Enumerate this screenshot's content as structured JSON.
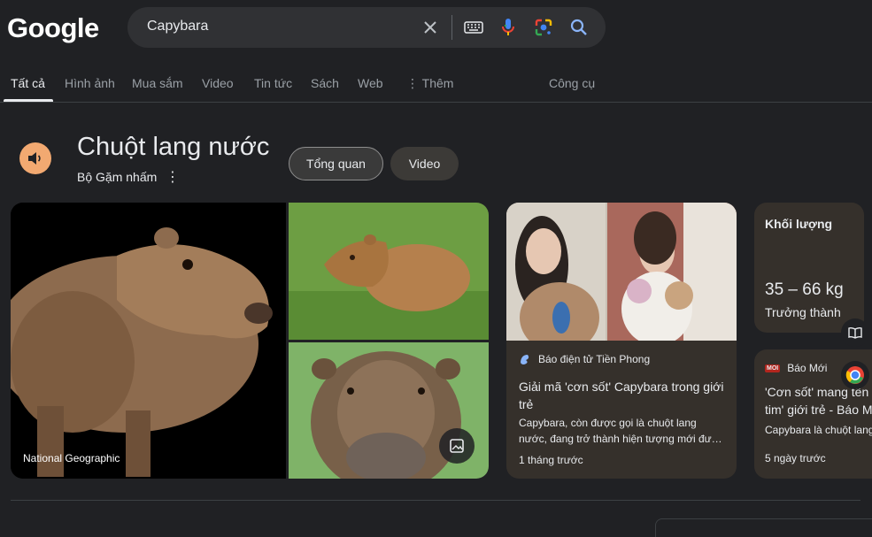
{
  "logo": "Google",
  "search": {
    "query": "Capybara"
  },
  "icons": {
    "clear": "close-icon",
    "keyboard": "keyboard-icon",
    "voice": "microphone-icon",
    "lens": "google-lens-icon",
    "search": "search-icon"
  },
  "tabs": [
    {
      "label": "Tất cả"
    },
    {
      "label": "Hình ảnh"
    },
    {
      "label": "Mua sắm"
    },
    {
      "label": "Video"
    },
    {
      "label": "Tin tức"
    },
    {
      "label": "Sách"
    },
    {
      "label": "Web"
    },
    {
      "label": "Thêm"
    }
  ],
  "tools_label": "Công cụ",
  "knowledge": {
    "title": "Chuột lang nước",
    "subtitle": "Bộ Gặm nhấm",
    "more": "⋮",
    "chips": [
      "Tổng quan",
      "Video"
    ]
  },
  "images": {
    "credit": "National Geographic"
  },
  "weight": {
    "label": "Khối lượng",
    "value": "35 – 66 kg",
    "sub": "Trưởng thành"
  },
  "news": [
    {
      "source": "Báo điện tử Tiền Phong",
      "title": "Giải mã 'cơn sốt' Capybara trong giới trẻ",
      "snippet": "Capybara, còn được gọi là chuột lang nước, đang trở thành hiện tượng mới đư…",
      "time": "1 tháng trước"
    },
    {
      "source": "Báo Mới",
      "source_logo": "MOI",
      "title": "'Cơn sốt' mang tên",
      "title_line2": "tim' giới trẻ - Báo M",
      "snippet": "Capybara là chuột lang",
      "time": "5 ngày trước"
    }
  ],
  "colors": {
    "background": "#202124",
    "card": "#35302b",
    "accent": "#f2a971"
  }
}
